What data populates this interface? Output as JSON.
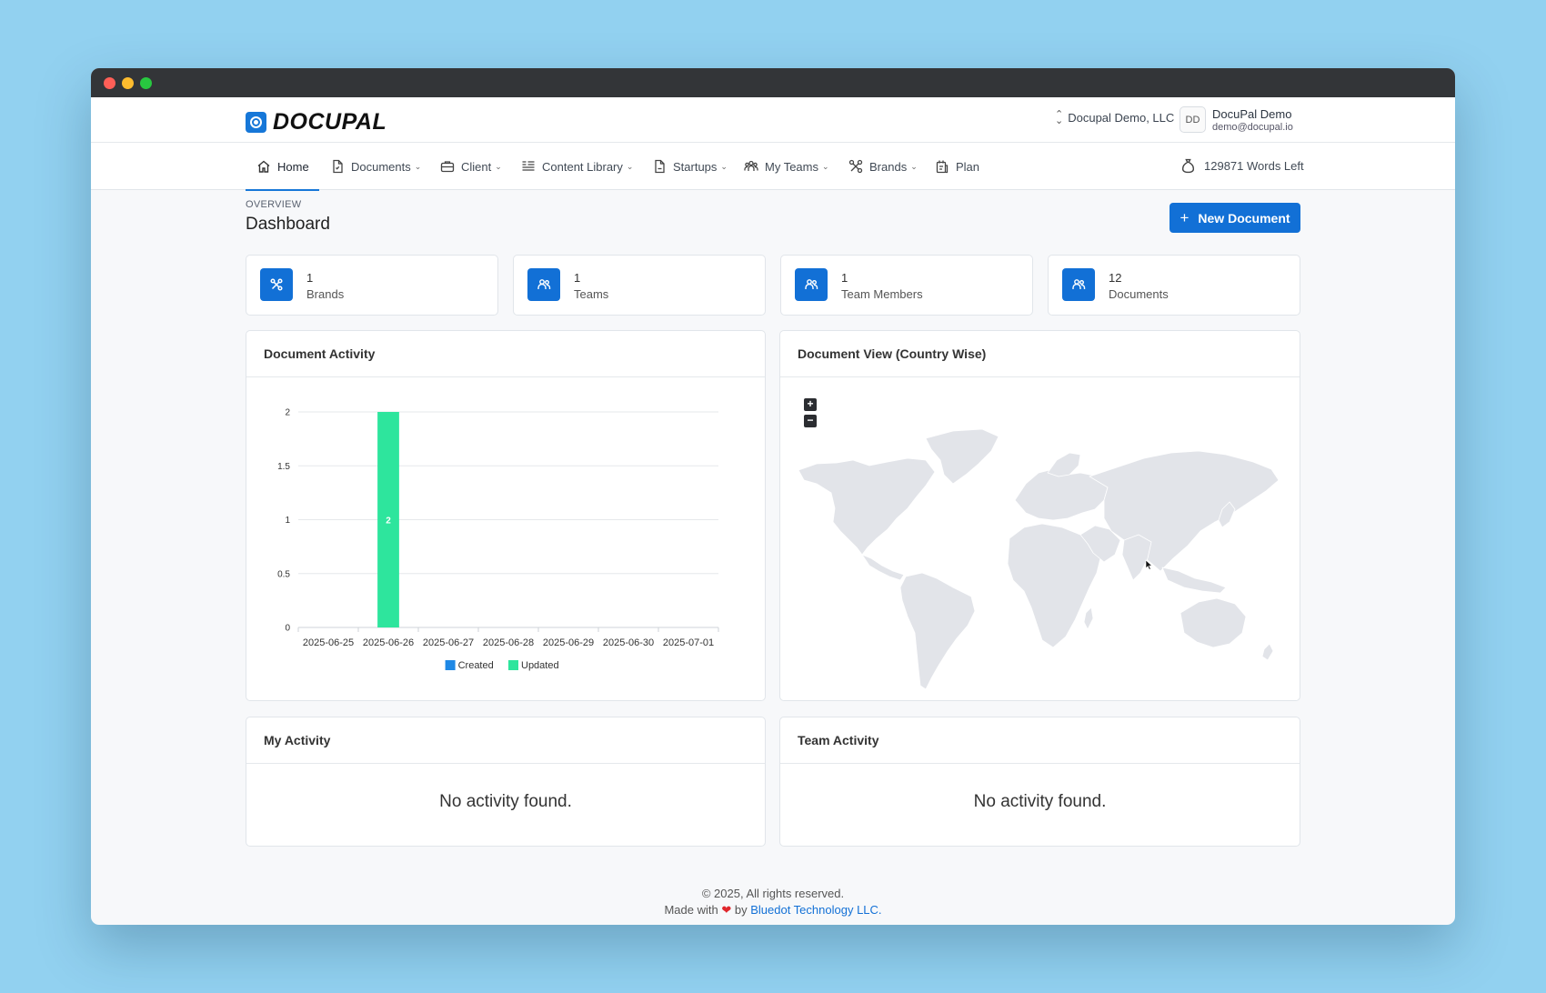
{
  "app": {
    "logo_text": "DOCUPAL",
    "org_name": "Docupal Demo, LLC",
    "user_initials": "DD",
    "user_name": "DocuPal Demo",
    "user_email": "demo@docupal.io"
  },
  "nav": {
    "items": [
      {
        "label": "Home",
        "icon": "home-icon"
      },
      {
        "label": "Documents",
        "icon": "document-icon"
      },
      {
        "label": "Client",
        "icon": "briefcase-icon"
      },
      {
        "label": "Content Library",
        "icon": "library-icon"
      },
      {
        "label": "Startups",
        "icon": "file-icon"
      },
      {
        "label": "My Teams",
        "icon": "team-icon"
      },
      {
        "label": "Brands",
        "icon": "brand-icon"
      },
      {
        "label": "Plan",
        "icon": "plan-icon"
      }
    ],
    "words_left": "129871 Words Left"
  },
  "page": {
    "overline": "OVERVIEW",
    "title": "Dashboard",
    "new_document_label": "New Document"
  },
  "stats": [
    {
      "value": "1",
      "label": "Brands",
      "icon": "brand-icon"
    },
    {
      "value": "1",
      "label": "Teams",
      "icon": "team-icon"
    },
    {
      "value": "1",
      "label": "Team Members",
      "icon": "team-icon"
    },
    {
      "value": "12",
      "label": "Documents",
      "icon": "team-icon"
    }
  ],
  "cards": {
    "document_activity_title": "Document Activity",
    "document_view_title": "Document View (Country Wise)",
    "my_activity_title": "My Activity",
    "team_activity_title": "Team Activity",
    "empty_text": "No activity found.",
    "map_zoom_in": "+",
    "map_zoom_out": "−"
  },
  "chart_data": {
    "type": "bar",
    "categories": [
      "2025-06-25",
      "2025-06-26",
      "2025-06-27",
      "2025-06-28",
      "2025-06-29",
      "2025-06-30",
      "2025-07-01"
    ],
    "series": [
      {
        "name": "Created",
        "values": [
          0,
          0,
          0,
          0,
          0,
          0,
          0
        ],
        "color": "#1e88e5"
      },
      {
        "name": "Updated",
        "values": [
          0,
          2,
          0,
          0,
          0,
          0,
          0
        ],
        "color": "#2ee59d"
      }
    ],
    "yticks": [
      "0",
      "0.5",
      "1",
      "1.5",
      "2"
    ],
    "ylim": [
      0,
      2
    ],
    "stacked": true,
    "data_labels": true,
    "grid": true,
    "legend_position": "bottom"
  },
  "footer": {
    "copyright": "© 2025, All rights reserved.",
    "made_with": "Made with",
    "by": "by",
    "company": "Bluedot Technology LLC."
  },
  "colors": {
    "primary": "#1270d6",
    "background": "#92d1f0",
    "map_land": "#e2e4e9"
  }
}
